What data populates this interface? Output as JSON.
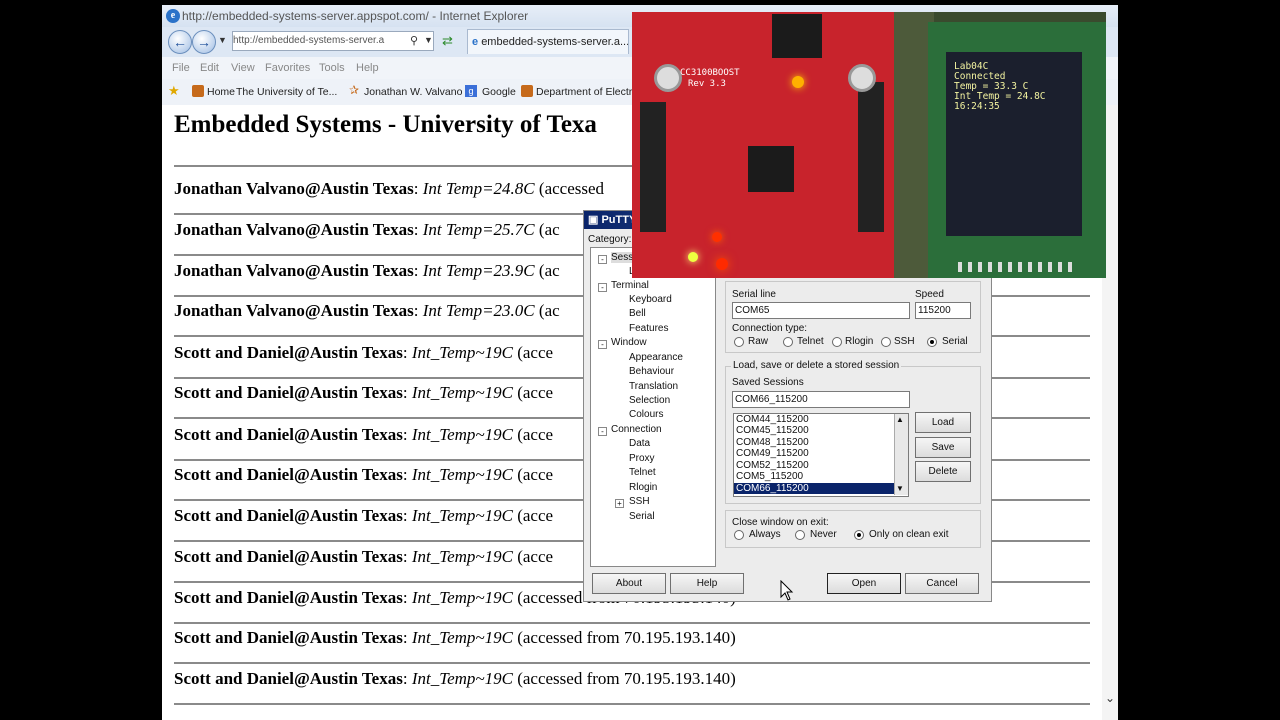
{
  "browser": {
    "title": "http://embedded-systems-server.appspot.com/ - Internet Explorer",
    "address": "http://embedded-systems-server.a",
    "tab": "embedded-systems-server.a...",
    "menu": [
      "File",
      "Edit",
      "View",
      "Favorites",
      "Tools",
      "Help"
    ],
    "favorites": [
      "Home",
      "The University of Te...",
      "Jonathan W. Valvano",
      "Google",
      "Department of Electric"
    ]
  },
  "page": {
    "heading": "Embedded Systems - University of Texa",
    "entries": [
      {
        "name": "Jonathan Valvano@Austin Texas",
        "temp": "Int Temp=24.8C",
        "rest": "(accessed"
      },
      {
        "name": "Jonathan Valvano@Austin Texas",
        "temp": "Int Temp=25.7C",
        "rest": "(ac"
      },
      {
        "name": "Jonathan Valvano@Austin Texas",
        "temp": "Int Temp=23.9C",
        "rest": "(ac"
      },
      {
        "name": "Jonathan Valvano@Austin Texas",
        "temp": "Int Temp=23.0C",
        "rest": "(ac"
      },
      {
        "name": "Scott and Daniel@Austin Texas",
        "temp": "Int_Temp~19C",
        "rest": "(acce"
      },
      {
        "name": "Scott and Daniel@Austin Texas",
        "temp": "Int_Temp~19C",
        "rest": "(acce"
      },
      {
        "name": "Scott and Daniel@Austin Texas",
        "temp": "Int_Temp~19C",
        "rest": "(acce"
      },
      {
        "name": "Scott and Daniel@Austin Texas",
        "temp": "Int_Temp~19C",
        "rest": "(acce"
      },
      {
        "name": "Scott and Daniel@Austin Texas",
        "temp": "Int_Temp~19C",
        "rest": "(acce"
      },
      {
        "name": "Scott and Daniel@Austin Texas",
        "temp": "Int_Temp~19C",
        "rest": "(acce"
      },
      {
        "name": "Scott and Daniel@Austin Texas",
        "temp": "Int_Temp~19C",
        "rest": "(accessed from 70.195.193.140)"
      },
      {
        "name": "Scott and Daniel@Austin Texas",
        "temp": "Int_Temp~19C",
        "rest": "(accessed from 70.195.193.140)"
      },
      {
        "name": "Scott and Daniel@Austin Texas",
        "temp": "Int_Temp~19C",
        "rest": "(accessed from 70.195.193.140)"
      }
    ]
  },
  "putty": {
    "title": "PuTTY",
    "category_label": "Category:",
    "tree": {
      "session": "Session",
      "logging": "L",
      "terminal": "Terminal",
      "keyboard": "Keyboard",
      "bell": "Bell",
      "features": "Features",
      "window": "Window",
      "appearance": "Appearance",
      "behaviour": "Behaviour",
      "translation": "Translation",
      "selection": "Selection",
      "colours": "Colours",
      "connection": "Connection",
      "data": "Data",
      "proxy": "Proxy",
      "telnet": "Telnet",
      "rlogin": "Rlogin",
      "ssh": "SSH",
      "serial": "Serial"
    },
    "serial_line_label": "Serial line",
    "serial_line_value": "COM65",
    "speed_label": "Speed",
    "speed_value": "115200",
    "conn_type_label": "Connection type:",
    "conn_types": {
      "raw": "Raw",
      "telnet": "Telnet",
      "rlogin": "Rlogin",
      "ssh": "SSH",
      "serial": "Serial"
    },
    "load_group_label": "Load, save or delete a stored session",
    "saved_sessions_label": "Saved Sessions",
    "saved_sessions_value": "COM66_115200",
    "sessions": [
      "COM44_115200",
      "COM45_115200",
      "COM48_115200",
      "COM49_115200",
      "COM52_115200",
      "COM5_115200",
      "COM66_115200"
    ],
    "load": "Load",
    "save": "Save",
    "delete": "Delete",
    "close_label": "Close window on exit:",
    "close_opts": {
      "always": "Always",
      "never": "Never",
      "clean": "Only on clean exit"
    },
    "about": "About",
    "help": "Help",
    "open": "Open",
    "cancel": "Cancel"
  },
  "photo": {
    "board_label": "CC3100BOOST",
    "board_rev": "Rev 3.3",
    "lcd_lines": [
      "Lab04C",
      "Connected",
      "Temp = 33.3 C",
      "Int Temp = 24.8C",
      "16:24:35"
    ]
  },
  "colors": {
    "board_red": "#c8232c",
    "lcd_text": "#f2f2a0",
    "putty_title": "#0a246a"
  }
}
